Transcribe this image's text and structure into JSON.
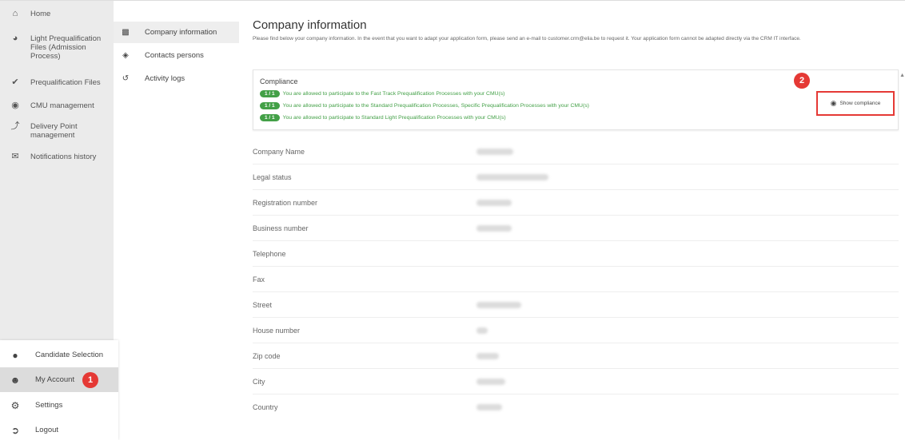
{
  "leftnav": {
    "items": [
      {
        "icon": "home-icon",
        "label": "Home"
      },
      {
        "icon": "compass-icon",
        "label": "Light Prequalification Files (Admission Process)"
      },
      {
        "icon": "badge-check-icon",
        "label": "Prequalification Files"
      },
      {
        "icon": "cmu-icon",
        "label": "CMU management"
      },
      {
        "icon": "bolt-icon",
        "label": "Delivery Point management"
      },
      {
        "icon": "mail-icon",
        "label": "Notifications history"
      }
    ],
    "bottom": [
      {
        "icon": "candidate-icon",
        "label": "Candidate Selection"
      },
      {
        "icon": "account-icon",
        "label": "My Account",
        "marker": "1"
      },
      {
        "icon": "gear-icon",
        "label": "Settings"
      },
      {
        "icon": "logout-icon",
        "label": "Logout"
      }
    ]
  },
  "subnav": {
    "items": [
      {
        "icon": "building-icon",
        "label": "Company information"
      },
      {
        "icon": "contacts-icon",
        "label": "Contacts persons"
      },
      {
        "icon": "history-icon",
        "label": "Activity logs"
      }
    ]
  },
  "main": {
    "title": "Company information",
    "description": "Please find below your company information. In the event that you want to adapt your application form, please send an e-mail to customer.crm@elia.be to request it. Your application form cannot be adapted directly via the CRM IT interface.",
    "compliance": {
      "title": "Compliance",
      "lines": [
        {
          "pill": "1 / 1",
          "text": "You are allowed to participate to the Fast Track Prequalification Processes with your CMU(s)"
        },
        {
          "pill": "1 / 1",
          "text": "You are allowed to participate to the Standard Prequalification Processes, Specific Prequalification Processes with your CMU(s)"
        },
        {
          "pill": "1 / 1",
          "text": "You are allowed to participate to Standard Light Prequalification Processes with your CMU(s)"
        }
      ],
      "show_label": "Show compliance",
      "marker": "2"
    },
    "fields": [
      {
        "label": "Company Name",
        "blurred": true
      },
      {
        "label": "Legal status",
        "blurred": true
      },
      {
        "label": "Registration number",
        "blurred": true
      },
      {
        "label": "Business number",
        "blurred": true
      },
      {
        "label": "Telephone",
        "blurred": false
      },
      {
        "label": "Fax",
        "blurred": false
      },
      {
        "label": "Street",
        "blurred": true
      },
      {
        "label": "House number",
        "blurred": true
      },
      {
        "label": "Zip code",
        "blurred": true
      },
      {
        "label": "City",
        "blurred": true
      },
      {
        "label": "Country",
        "blurred": true
      }
    ]
  },
  "colors": {
    "accent_green": "#43a047",
    "marker_red": "#e53935",
    "nav_bg": "#ebebeb"
  }
}
